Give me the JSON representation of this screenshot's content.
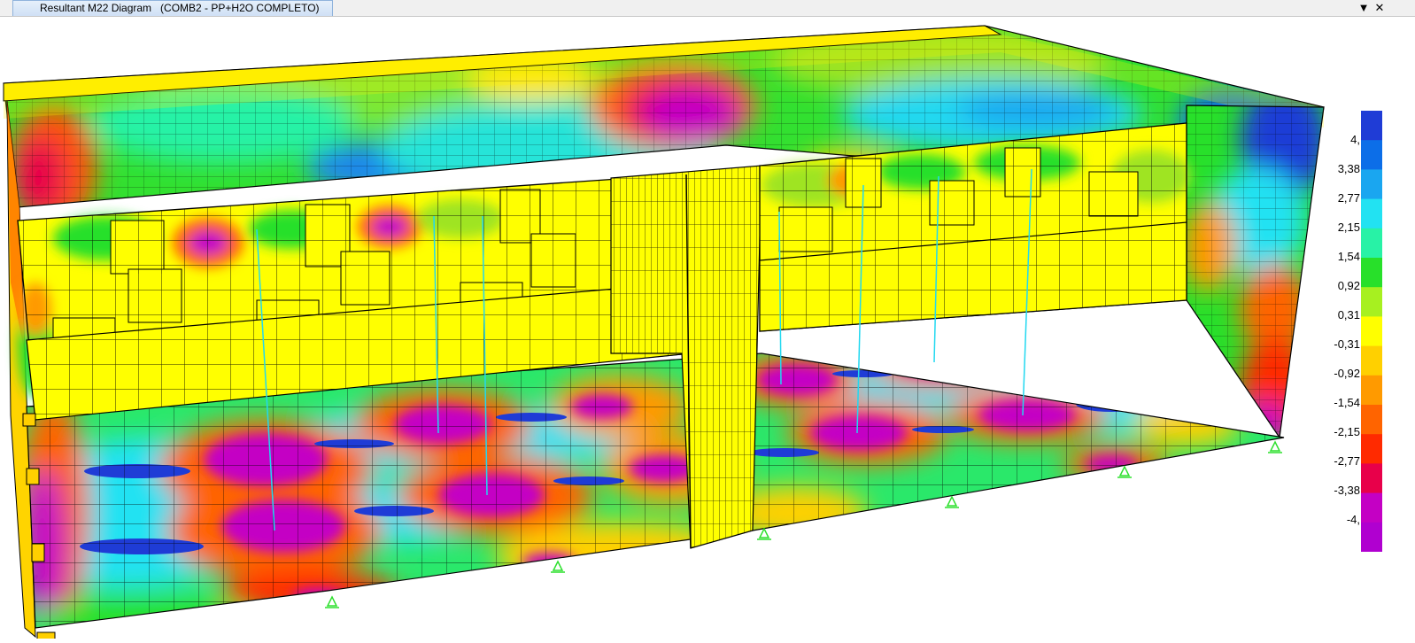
{
  "window": {
    "tab_title": "Resultant M22 Diagram   (COMB2 - PP+H2O COMPLETO)",
    "dropdown_glyph": "▼",
    "close_glyph": "✕"
  },
  "legend": {
    "labels": [
      "4,",
      "3,38",
      "2,77",
      "2,15",
      "1,54",
      "0,92",
      "0,31",
      "-0,31",
      "-0,92",
      "-1,54",
      "-2,15",
      "-2,77",
      "-3,38",
      "-4,"
    ],
    "colors": [
      "#1f3cd6",
      "#0c6ee8",
      "#1aa6f0",
      "#22e2f2",
      "#28f2a6",
      "#28e02a",
      "#a7f020",
      "#ffff00",
      "#ffd000",
      "#ff9a00",
      "#ff6400",
      "#ff2a00",
      "#e8004a",
      "#c400c4",
      "#b000d0"
    ]
  },
  "icons": {
    "support": "pin-support-icon"
  }
}
